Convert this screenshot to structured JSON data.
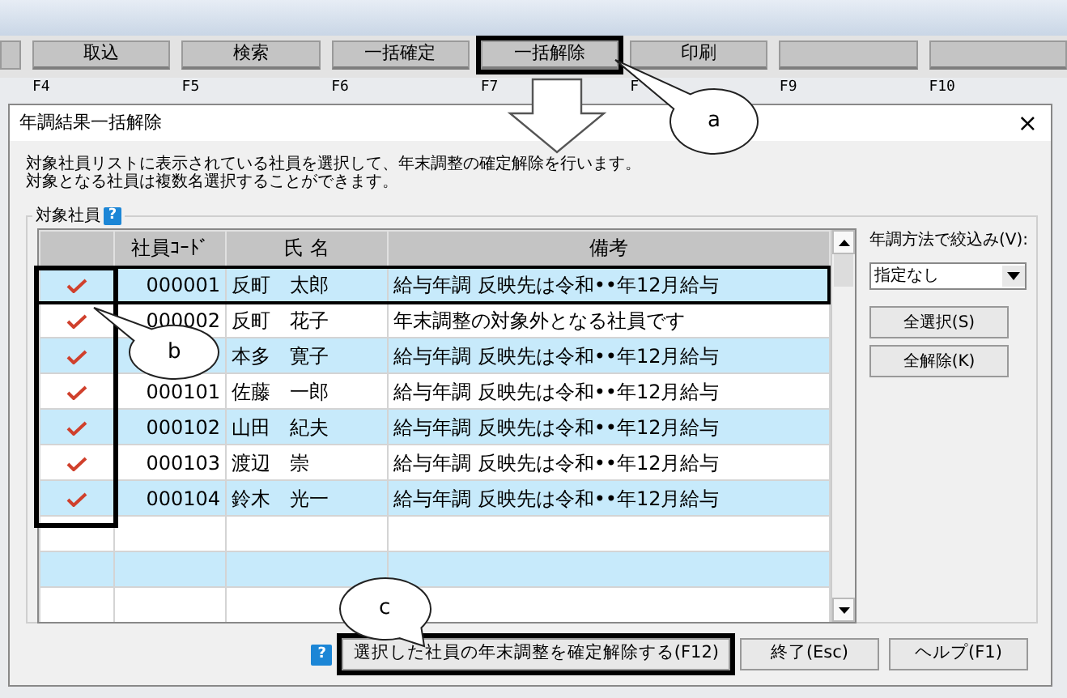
{
  "function_keys": [
    {
      "label": "取込",
      "key": "F4",
      "highlighted": false
    },
    {
      "label": "検索",
      "key": "F5",
      "highlighted": false
    },
    {
      "label": "一括確定",
      "key": "F6",
      "highlighted": false
    },
    {
      "label": "一括解除",
      "key": "F7",
      "highlighted": true
    },
    {
      "label": "印刷",
      "key": "F",
      "highlighted": false
    },
    {
      "key": "F9",
      "highlighted": false
    },
    {
      "key": "F10",
      "highlighted": false
    }
  ],
  "dialog": {
    "title": "年調結果一括解除",
    "close": "×",
    "description": [
      "対象社員リストに表示されている社員を選択して、年末調整の確定解除を行います。",
      "対象となる社員は複数名選択することができます。"
    ],
    "group_label": "対象社員",
    "group_help": "?",
    "table": {
      "columns": [
        "社員ｺｰﾄﾞ",
        "氏 名",
        "備考"
      ],
      "rows": [
        {
          "checked": true,
          "selected": true,
          "code": "000001",
          "name": "反町　太郎",
          "note": "給与年調 反映先は令和••年12月給与"
        },
        {
          "checked": true,
          "selected": false,
          "code": "000002",
          "name": "反町　花子",
          "note": "年末調整の対象外となる社員です"
        },
        {
          "checked": true,
          "selected": false,
          "name": "本多　寛子",
          "note": "給与年調 反映先は令和••年12月給与"
        },
        {
          "checked": true,
          "selected": false,
          "code": "000101",
          "name": "佐藤　一郎",
          "note": "給与年調 反映先は令和••年12月給与"
        },
        {
          "checked": true,
          "selected": false,
          "code": "000102",
          "name": "山田　紀夫",
          "note": "給与年調 反映先は令和••年12月給与"
        },
        {
          "checked": true,
          "selected": false,
          "code": "000103",
          "name": "渡辺　崇",
          "note": "給与年調 反映先は令和••年12月給与"
        },
        {
          "checked": true,
          "selected": false,
          "code": "000104",
          "name": "鈴木　光一",
          "note": "給与年調 反映先は令和••年12月給与"
        }
      ]
    },
    "filter": {
      "label": "年調方法で絞込み(V):",
      "value": "指定なし"
    },
    "side_buttons": [
      "全選択(S)",
      "全解除(K)"
    ],
    "footer_help": "?",
    "footer_buttons": [
      {
        "label": "選択した社員の年末調整を確定解除する(F12)",
        "highlighted": true
      },
      {
        "label": "終了(Esc)",
        "highlighted": false
      },
      {
        "label": "ヘルプ(F1)",
        "highlighted": false
      }
    ]
  },
  "callouts": [
    {
      "letter": "a"
    },
    {
      "letter": "b"
    },
    {
      "letter": "c"
    }
  ]
}
